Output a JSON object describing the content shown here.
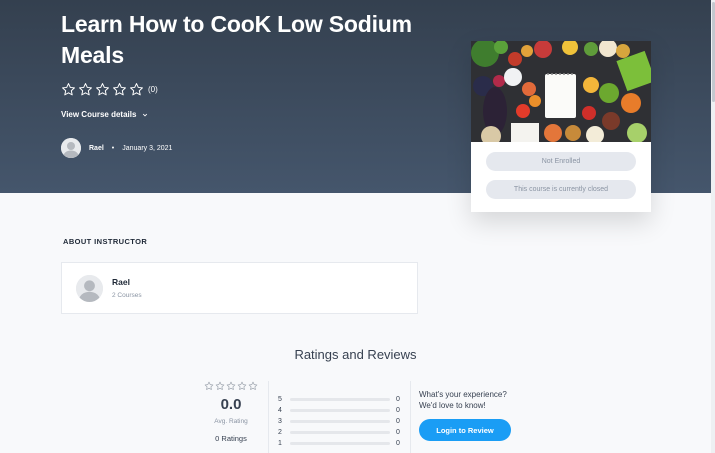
{
  "course": {
    "title": "Learn How to CooK Low Sodium Meals",
    "rating_count": "(0)",
    "details_link": "View Course details",
    "author": "Rael",
    "date": "January 3, 2021",
    "rating_stars": 0
  },
  "enroll_card": {
    "image_alt": "vegetables-and-notepad-image",
    "status_pill": "Not Enrolled",
    "closed_pill": "This course is currently closed"
  },
  "about": {
    "label": "ABOUT INSTRUCTOR",
    "instructor_name": "Rael",
    "instructor_courses": "2 Courses"
  },
  "ratings": {
    "title": "Ratings and Reviews",
    "average": "0.0",
    "average_label": "Avg. Rating",
    "total": "0 Ratings",
    "breakdown": [
      {
        "stars": "5",
        "count": "0",
        "fraction": 0
      },
      {
        "stars": "4",
        "count": "0",
        "fraction": 0
      },
      {
        "stars": "3",
        "count": "0",
        "fraction": 0
      },
      {
        "stars": "2",
        "count": "0",
        "fraction": 0
      },
      {
        "stars": "1",
        "count": "0",
        "fraction": 0
      }
    ],
    "cta_text": "What's your experience? We'd love to know!",
    "cta_button": "Login to Review"
  },
  "colors": {
    "hero": "#3c4a5c",
    "accent": "#1a9df5",
    "pill_bg": "#e5e8ee"
  }
}
